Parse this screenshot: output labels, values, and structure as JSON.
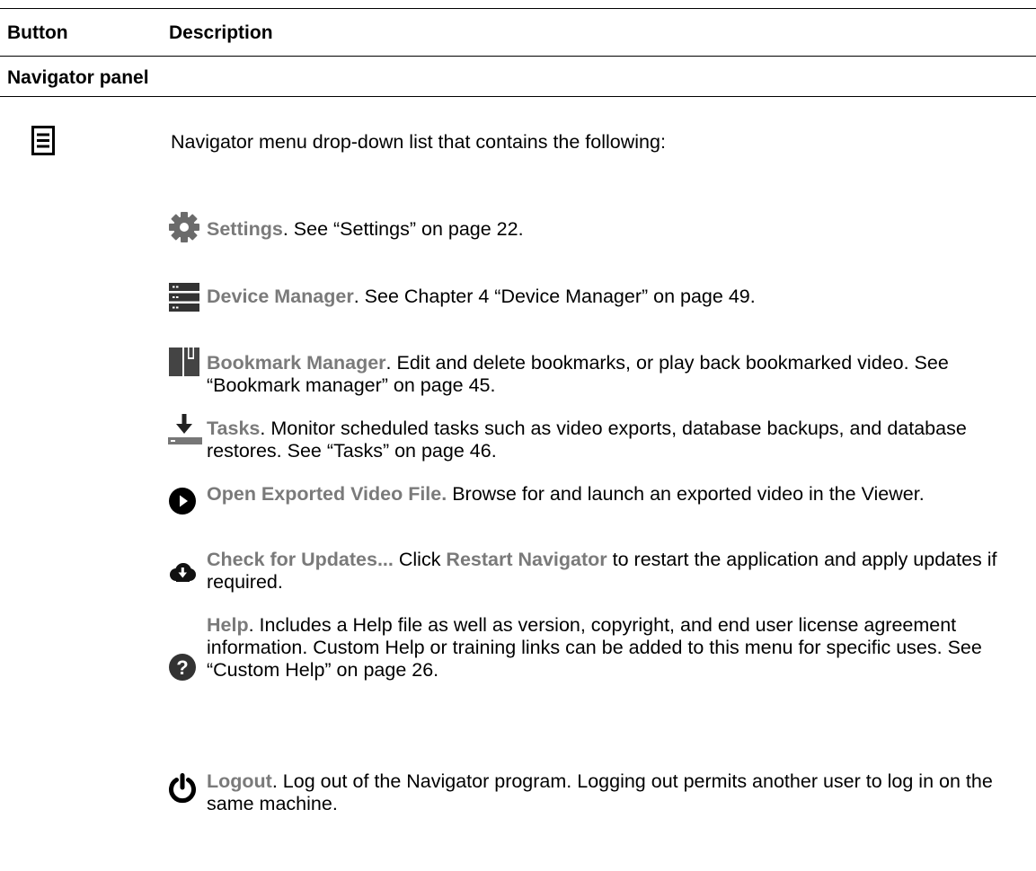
{
  "table": {
    "col_button": "Button",
    "col_description": "Description",
    "section": "Navigator panel"
  },
  "menu": {
    "icon": "hamburger-menu-icon",
    "description": "Navigator menu drop-down list that contains the following:"
  },
  "items": [
    {
      "icon": "gear-icon",
      "name": "Settings",
      "desc": ". See “Settings” on page 22."
    },
    {
      "icon": "server-icon",
      "name": "Device Manager",
      "desc": ". See Chapter 4 “Device Manager” on page 49."
    },
    {
      "icon": "bookmark-book-icon",
      "name": "Bookmark Manager",
      "desc": ". Edit and delete bookmarks, or play back bookmarked video. See “Bookmark manager” on page 45."
    },
    {
      "icon": "download-tray-icon",
      "name": "Tasks",
      "desc": ". Monitor scheduled tasks such as video exports, database backups, and database restores. See “Tasks” on page 46."
    },
    {
      "icon": "play-circle-icon",
      "name": "Open Exported Video File.",
      "desc": " Browse for and launch an exported video in the Viewer."
    },
    {
      "icon": "cloud-download-icon",
      "name": "Check for Updates...",
      "desc": " Click ",
      "name2": "Restart Navigator",
      "desc2": " to restart the application and apply updates if required."
    },
    {
      "icon": "help-circle-icon",
      "name": "Help",
      "desc": ". Includes a Help file as well as version, copyright, and end user license agreement information. Custom Help or training links can be added to this menu for specific uses. See “Custom Help” on page 26."
    },
    {
      "icon": "power-icon",
      "name": "Logout",
      "desc": ". Log out of the Navigator program. Logging out permits another user to log in on the same machine."
    }
  ]
}
